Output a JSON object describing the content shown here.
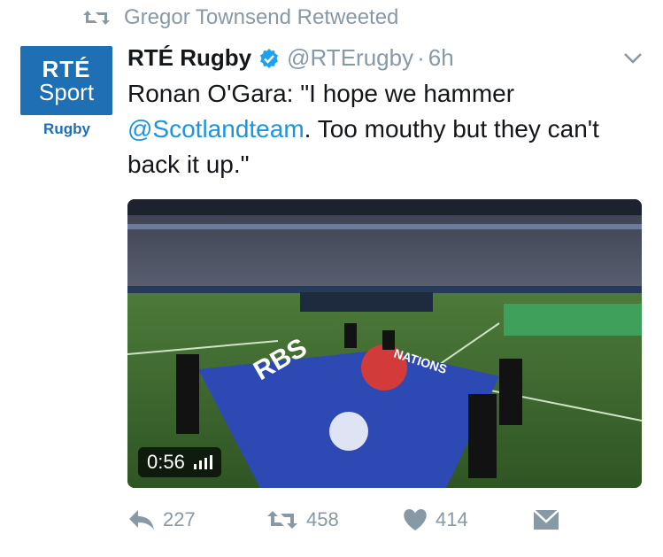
{
  "retweet_context": {
    "label": "Gregor Townsend Retweeted"
  },
  "author": {
    "display_name": "RTÉ Rugby",
    "handle": "@RTErugby",
    "separator": "·",
    "time": "6h",
    "avatar": {
      "line1": "RTÉ",
      "line2": "Sport",
      "line3": "Rugby"
    }
  },
  "tweet": {
    "text_before": "Ronan O'Gara: \"I hope we hammer ",
    "mention": "@Scotlandteam",
    "text_after": ". Too mouthy but they can't back it up.\""
  },
  "media": {
    "duration": "0:56",
    "flag_text": "RBS",
    "flag_text2": "NATIONS"
  },
  "actions": {
    "reply_count": "227",
    "retweet_count": "458",
    "like_count": "414"
  },
  "colors": {
    "brand_blue": "#1f6fb4",
    "mention_blue": "#1b95e0",
    "muted_gray": "#8899a6",
    "text": "#14171a"
  },
  "icons": [
    "retweet-icon",
    "verified-badge-icon",
    "chevron-down-icon",
    "reply-icon",
    "like-icon",
    "direct-message-icon",
    "volume-bars-icon"
  ]
}
